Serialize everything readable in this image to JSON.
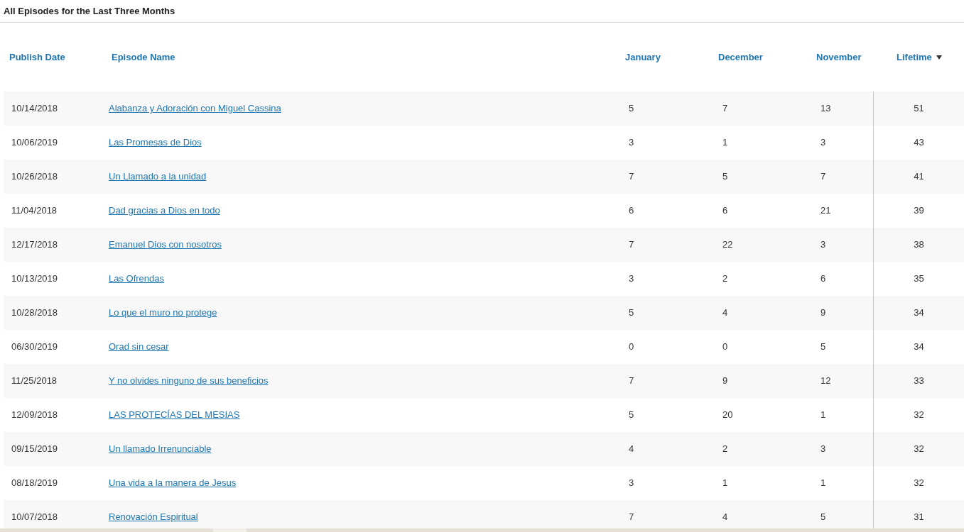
{
  "title": "All Episodes for the Last Three Months",
  "table": {
    "columns": [
      {
        "label": "Publish Date",
        "sorted": false
      },
      {
        "label": "Episode Name",
        "sorted": false
      },
      {
        "label": "January",
        "sorted": false
      },
      {
        "label": "December",
        "sorted": false
      },
      {
        "label": "November",
        "sorted": false
      },
      {
        "label": "Lifetime",
        "sorted": true
      }
    ],
    "rows": [
      {
        "date": "10/14/2018",
        "name": "Alabanza y Adoración con Miguel Cassina",
        "january": "5",
        "december": "7",
        "november": "13",
        "lifetime": "51"
      },
      {
        "date": "10/06/2019",
        "name": "Las Promesas de Dios",
        "january": "3",
        "december": "1",
        "november": "3",
        "lifetime": "43"
      },
      {
        "date": "10/26/2018",
        "name": "Un Llamado a la unidad",
        "january": "7",
        "december": "5",
        "november": "7",
        "lifetime": "41"
      },
      {
        "date": "11/04/2018",
        "name": "Dad gracias a Dios en todo",
        "january": "6",
        "december": "6",
        "november": "21",
        "lifetime": "39"
      },
      {
        "date": "12/17/2018",
        "name": "Emanuel Dios con nosotros",
        "january": "7",
        "december": "22",
        "november": "3",
        "lifetime": "38"
      },
      {
        "date": "10/13/2019",
        "name": "Las Ofrendas",
        "january": "3",
        "december": "2",
        "november": "6",
        "lifetime": "35"
      },
      {
        "date": "10/28/2018",
        "name": "Lo que el muro no protege",
        "january": "5",
        "december": "4",
        "november": "9",
        "lifetime": "34"
      },
      {
        "date": "06/30/2019",
        "name": "Orad sin cesar",
        "january": "0",
        "december": "0",
        "november": "5",
        "lifetime": "34"
      },
      {
        "date": "11/25/2018",
        "name": "Y no olvides ninguno de sus beneficios",
        "january": "7",
        "december": "9",
        "november": "12",
        "lifetime": "33"
      },
      {
        "date": "12/09/2018",
        "name": "LAS PROTECÍAS DEL MESIAS",
        "january": "5",
        "december": "20",
        "november": "1",
        "lifetime": "32"
      },
      {
        "date": "09/15/2019",
        "name": "Un llamado Irrenunciable",
        "january": "4",
        "december": "2",
        "november": "3",
        "lifetime": "32"
      },
      {
        "date": "08/18/2019",
        "name": "Una vida a la manera de Jesus",
        "january": "3",
        "december": "1",
        "november": "1",
        "lifetime": "32"
      },
      {
        "date": "10/07/2018",
        "name": "Renovación Espiritual",
        "january": "7",
        "december": "4",
        "november": "5",
        "lifetime": "31"
      }
    ]
  }
}
